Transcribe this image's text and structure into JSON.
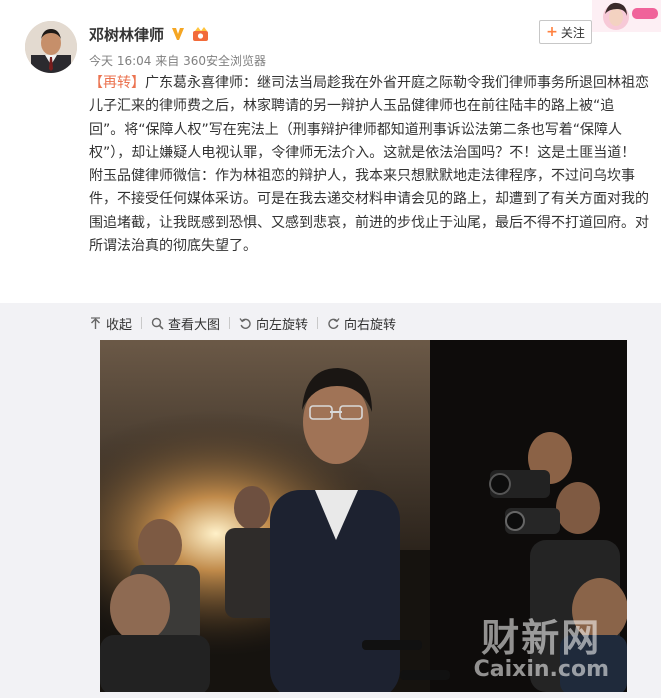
{
  "post": {
    "author": "邓树林律师",
    "time": "今天 16:04",
    "source_prefix": "来自",
    "source": "360安全浏览器",
    "follow_label": "关注",
    "follow_plus": "+",
    "repost_tag": "【再转】",
    "body": "广东葛永喜律师：继司法当局趁我在外省开庭之际勒令我们律师事务所退回林祖恋儿子汇来的律师费之后，林家聘请的另一辩护人玉品健律师也在前往陆丰的路上被“追回”。将“保障人权”写在宪法上（刑事辩护律师都知道刑事诉讼法第二条也写着“保障人权”），却让嫌疑人电视认罪，令律师无法介入。这就是依法治国吗？不！这是土匪当道！　　附玉品健律师微信：作为林祖恋的辩护人，我本来只想默默地走法律程序，不过问乌坎事件，不接受任何媒体采访。可是在我去递交材料申请会见的路上，却遭到了有关方面对我的围追堵截，让我既感到恐惧、又感到悲哀，前进的步伐止于汕尾，最后不得不打道回府。对所谓法治真的彻底失望了。"
  },
  "toolbar": {
    "collapse": "收起",
    "view_large": "查看大图",
    "rotate_left": "向左旋转",
    "rotate_right": "向右旋转"
  },
  "image": {
    "watermark_cn": "财新网",
    "watermark_en": "Caixin.com"
  },
  "icons": {
    "verified": "verified-v-icon",
    "vip_badge": "vip-badge-icon",
    "collapse": "arrow-up-icon",
    "view_large": "magnifier-icon",
    "rotate_left": "rotate-left-icon",
    "rotate_right": "rotate-right-icon"
  },
  "colors": {
    "accent": "#eb7350",
    "verified": "#f5a623",
    "repost_bg": "#f2f2f5",
    "meta": "#808080"
  }
}
